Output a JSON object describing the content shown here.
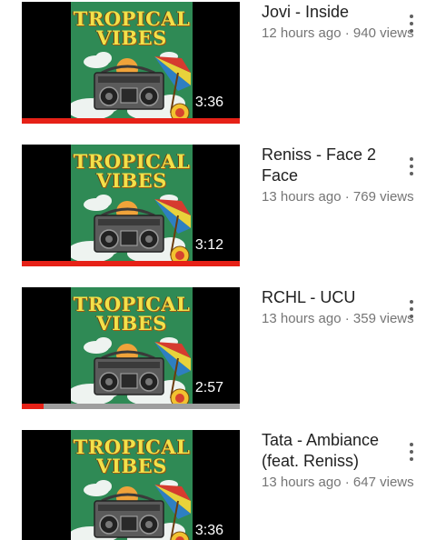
{
  "videos": [
    {
      "title": "Jovi - Inside",
      "time_ago": "12 hours ago",
      "views": "940 views",
      "duration": "3:36",
      "watch_progress": 1.0,
      "thumbnail": {
        "title_line1": "TROPICAL",
        "title_line2": "VIBES"
      }
    },
    {
      "title": "Reniss - Face 2 Face",
      "time_ago": "13 hours ago",
      "views": "769 views",
      "duration": "3:12",
      "watch_progress": 1.0,
      "thumbnail": {
        "title_line1": "TROPICAL",
        "title_line2": "VIBES"
      }
    },
    {
      "title": "RCHL - UCU",
      "time_ago": "13 hours ago",
      "views": "359 views",
      "duration": "2:57",
      "watch_progress": 0.1,
      "thumbnail": {
        "title_line1": "TROPICAL",
        "title_line2": "VIBES"
      }
    },
    {
      "title": "Tata - Ambiance (feat. Reniss)",
      "time_ago": "13 hours ago",
      "views": "647 views",
      "duration": "3:36",
      "watch_progress": 0,
      "thumbnail": {
        "title_line1": "TROPICAL",
        "title_line2": "VIBES"
      }
    }
  ],
  "meta_separator": " · ",
  "colors": {
    "progress": "#e62117",
    "progress_track": "#9e9e9e",
    "thumb_background": "#000000",
    "art_green": "#2f8a55",
    "title_text": "#212121",
    "meta_text": "#757575"
  },
  "icons": {
    "more": "more-vert-icon",
    "art_boombox": "boombox-icon",
    "art_umbrella": "beach-umbrella-icon",
    "art_clouds": "cloud-icon",
    "art_stamp": "stamp-icon"
  }
}
